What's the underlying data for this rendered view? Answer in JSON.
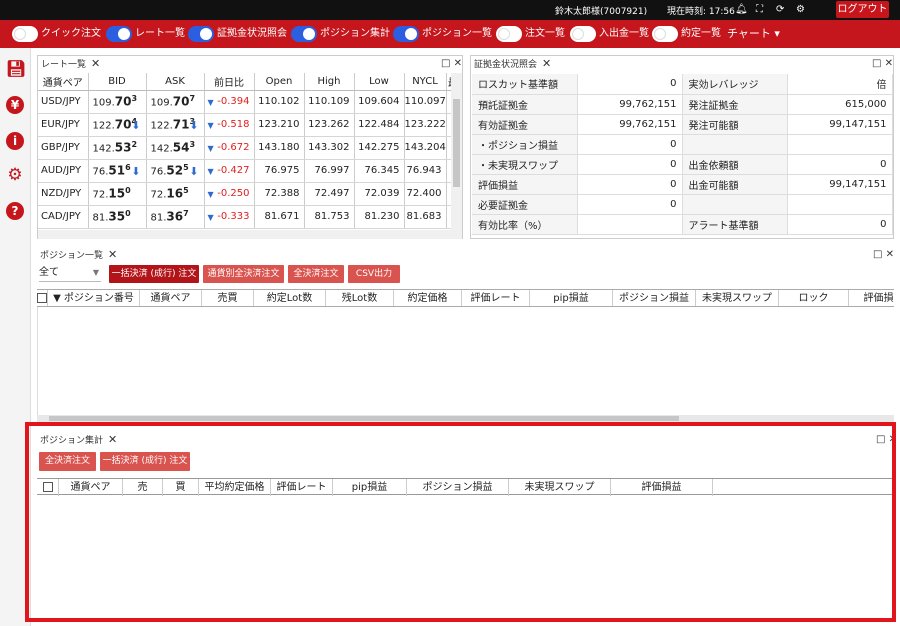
{
  "topbar": {
    "user": "鈴木太郎様(7007921)",
    "clock": "現在時刻: 17:56",
    "logout": "ログアウト"
  },
  "redbar": {
    "toggles": [
      {
        "label": "クイック注文",
        "on": false
      },
      {
        "label": "レート一覧",
        "on": true
      },
      {
        "label": "証拠金状況照会",
        "on": true
      },
      {
        "label": "ポジション集計",
        "on": true
      },
      {
        "label": "ポジション一覧",
        "on": true
      },
      {
        "label": "注文一覧",
        "on": false
      },
      {
        "label": "入出金一覧",
        "on": false
      },
      {
        "label": "約定一覧",
        "on": false
      }
    ],
    "chart_menu": "チャート ▾"
  },
  "rate_pane": {
    "title": "レート一覧",
    "headers": [
      "通貨ペア",
      "BID",
      "ASK",
      "前日比",
      "Open",
      "High",
      "Low",
      "NYCL",
      "最終"
    ],
    "rows": [
      {
        "pair": "USD/JPY",
        "bid_main": "109.",
        "bid_big": "70",
        "bid_sup": "3",
        "bid_down": false,
        "ask_main": "109.",
        "ask_big": "70",
        "ask_sup": "7",
        "ask_down": false,
        "chg": "-0.394",
        "open": "110.102",
        "high": "110.109",
        "low": "109.604",
        "nycl": "110.097"
      },
      {
        "pair": "EUR/JPY",
        "bid_main": "122.",
        "bid_big": "70",
        "bid_sup": "4",
        "bid_down": true,
        "ask_main": "122.",
        "ask_big": "71",
        "ask_sup": "3",
        "ask_down": true,
        "chg": "-0.518",
        "open": "123.210",
        "high": "123.262",
        "low": "122.484",
        "nycl": "123.222"
      },
      {
        "pair": "GBP/JPY",
        "bid_main": "142.",
        "bid_big": "53",
        "bid_sup": "2",
        "bid_down": false,
        "ask_main": "142.",
        "ask_big": "54",
        "ask_sup": "3",
        "ask_down": false,
        "chg": "-0.672",
        "open": "143.180",
        "high": "143.302",
        "low": "142.275",
        "nycl": "143.204"
      },
      {
        "pair": "AUD/JPY",
        "bid_main": "76.",
        "bid_big": "51",
        "bid_sup": "6",
        "bid_down": true,
        "ask_main": "76.",
        "ask_big": "52",
        "ask_sup": "5",
        "ask_down": true,
        "chg": "-0.427",
        "open": "76.975",
        "high": "76.997",
        "low": "76.345",
        "nycl": "76.943"
      },
      {
        "pair": "NZD/JPY",
        "bid_main": "72.",
        "bid_big": "15",
        "bid_sup": "0",
        "bid_down": false,
        "ask_main": "72.",
        "ask_big": "16",
        "ask_sup": "5",
        "ask_down": false,
        "chg": "-0.250",
        "open": "72.388",
        "high": "72.497",
        "low": "72.039",
        "nycl": "72.400"
      },
      {
        "pair": "CAD/JPY",
        "bid_main": "81.",
        "bid_big": "35",
        "bid_sup": "0",
        "bid_down": false,
        "ask_main": "81.",
        "ask_big": "36",
        "ask_sup": "7",
        "ask_down": false,
        "chg": "-0.333",
        "open": "81.671",
        "high": "81.753",
        "low": "81.230",
        "nycl": "81.683"
      }
    ]
  },
  "margin_pane": {
    "title": "証拠金状況照会",
    "rows": [
      [
        "ロスカット基準額",
        "0",
        "実効レバレッジ",
        "倍"
      ],
      [
        "預託証拠金",
        "99,762,151",
        "発注証拠金",
        "615,000"
      ],
      [
        "有効証拠金",
        "99,762,151",
        "発注可能額",
        "99,147,151"
      ],
      [
        "・ポジション損益",
        "0",
        "",
        ""
      ],
      [
        "・未実現スワップ",
        "0",
        "出金依頼額",
        "0"
      ],
      [
        "評価損益",
        "0",
        "出金可能額",
        "99,147,151"
      ],
      [
        "必要証拠金",
        "0",
        "",
        ""
      ],
      [
        "有効比率（%）",
        "",
        "アラート基準額",
        "0"
      ]
    ]
  },
  "position_list": {
    "title": "ポジション一覧",
    "filter": "全て",
    "buttons": [
      "一括決済 (成行) 注文",
      "通貨別全決済注文",
      "全決済注文",
      "CSV出力"
    ],
    "columns": [
      "▼ ポジション番号",
      "通貨ペア",
      "売買",
      "約定Lot数",
      "残Lot数",
      "約定価格",
      "評価レート",
      "pip損益",
      "ポジション損益",
      "未実現スワップ",
      "ロック",
      "評価損"
    ]
  },
  "position_summary": {
    "title": "ポジション集計",
    "buttons": [
      "全決済注文",
      "一括決済 (成行) 注文"
    ],
    "columns": [
      "通貨ペア",
      "売",
      "買",
      "平均約定価格",
      "評価レート",
      "pip損益",
      "ポジション損益",
      "未実現スワップ",
      "評価損益"
    ]
  }
}
